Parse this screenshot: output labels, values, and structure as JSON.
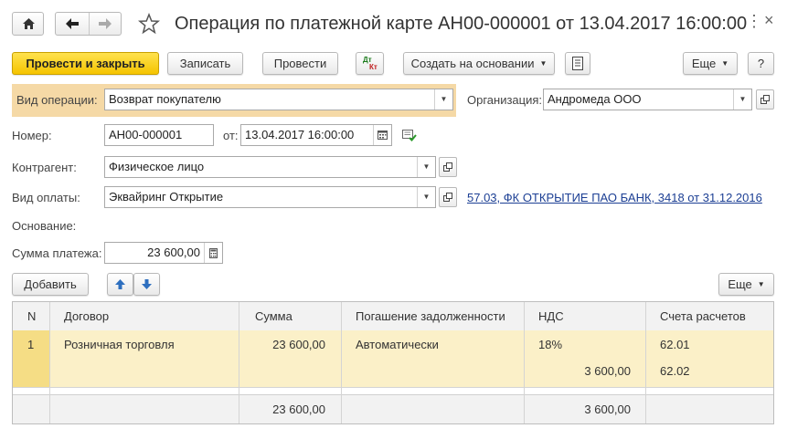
{
  "window": {
    "title": "Операция по платежной карте АН00-000001 от 13.04.2017 16:00:00"
  },
  "toolbar": {
    "post_close": "Провести и закрыть",
    "save": "Записать",
    "post": "Провести",
    "create_based": "Создать на основании",
    "more": "Еще",
    "help": "?",
    "dt_kt_top": "Дт",
    "dt_kt_bottom": "Кт"
  },
  "form": {
    "op_type_label": "Вид операции:",
    "op_type_value": "Возврат покупателю",
    "org_label": "Организация:",
    "org_value": "Андромеда ООО",
    "number_label": "Номер:",
    "number_value": "АН00-000001",
    "date_label": "от:",
    "date_value": "13.04.2017 16:00:00",
    "counterparty_label": "Контрагент:",
    "counterparty_value": "Физическое лицо",
    "payment_type_label": "Вид оплаты:",
    "payment_type_value": "Эквайринг Открытие",
    "bank_link": "57.03, ФК ОТКРЫТИЕ ПАО БАНК, 3418 от 31.12.2016",
    "basis_label": "Основание:",
    "amount_label": "Сумма платежа:",
    "amount_value": "23 600,00"
  },
  "table_toolbar": {
    "add": "Добавить",
    "more": "Еще"
  },
  "table": {
    "columns": [
      "N",
      "Договор",
      "Сумма",
      "Погашение задолженности",
      "НДС",
      "Счета расчетов"
    ],
    "row": {
      "n": "1",
      "contract": "Розничная торговля",
      "sum": "23 600,00",
      "repayment": "Автоматически",
      "vat_rate": "18%",
      "vat_amount": "3 600,00",
      "account1": "62.01",
      "account2": "62.02"
    },
    "footer": {
      "sum": "23 600,00",
      "vat": "3 600,00"
    }
  },
  "colors": {
    "accent_yellow": "#f5c400",
    "highlight_row": "#fbf0c8",
    "header_bg": "#f2f2f2",
    "label_highlight": "#f5d9a6",
    "link": "#1c3f94"
  }
}
